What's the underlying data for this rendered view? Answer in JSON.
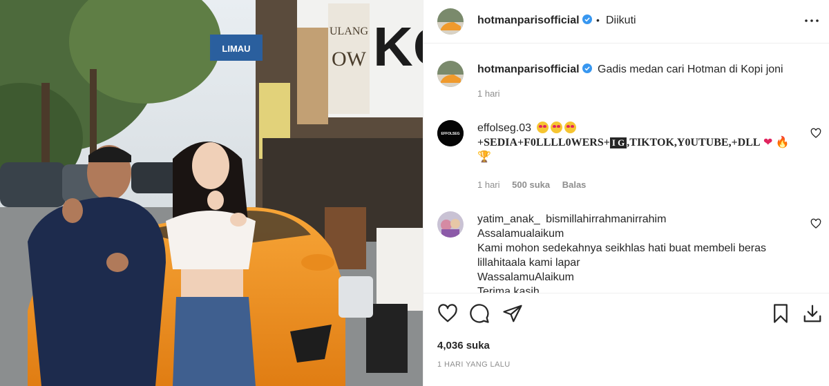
{
  "post": {
    "username": "hotmanparisofficial",
    "verified": true,
    "separator": "•",
    "follow_status": "Diikuti",
    "caption": "Gadis medan cari Hotman di Kopi joni",
    "caption_time": "1 hari",
    "likes": "4,036 suka",
    "posted_ago": "1 HARI YANG LALU"
  },
  "photo": {
    "sign_limau": "LIMAU",
    "sign_kopi": "KO",
    "sign_ulang": "ULANG",
    "sign_dow": "OW"
  },
  "comments": [
    {
      "username": "effolseg.03",
      "avatar_text": "EFFOLSEG",
      "line1_emoji_count": 3,
      "line2_a": "+SEDIA+F0LLLL0WERS+",
      "line2_ig": "I G",
      "line2_b": ",TIKTOK,Y0UTUBE,+DLL",
      "line2_heart": "❤",
      "line2_fire": "🔥",
      "line3_trophy": "🏆",
      "time": "1 hari",
      "likes": "500 suka",
      "reply": "Balas"
    },
    {
      "username": "yatim_anak_",
      "first_line": "bismillahirrahmanirrahim",
      "lines": [
        "Assalamualaikum",
        "Kami mohon sedekahnya seikhlas hati buat membeli beras",
        "lillahitaala kami lapar",
        "WassalamuAlaikum",
        "Terima kasih"
      ]
    }
  ],
  "icons": {
    "more": "more-options-icon",
    "like": "heart-icon",
    "comment": "comment-icon",
    "share": "share-icon",
    "save": "bookmark-icon",
    "download": "download-icon"
  }
}
